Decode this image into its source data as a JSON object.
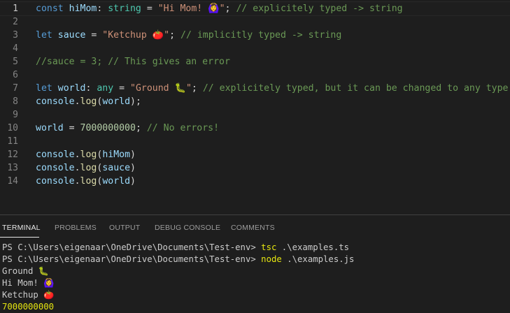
{
  "editor": {
    "lines": [
      {
        "num": "1",
        "parts": [
          [
            "kw",
            "const "
          ],
          [
            "var",
            "hiMom"
          ],
          [
            "op",
            ": "
          ],
          [
            "type",
            "string"
          ],
          [
            "op",
            " = "
          ],
          [
            "str",
            "\"Hi Mom! "
          ],
          [
            "emoji",
            "🙆‍♀️"
          ],
          [
            "str",
            "\""
          ],
          [
            "op",
            "; "
          ],
          [
            "com",
            "// explicitely typed -> string"
          ]
        ]
      },
      {
        "num": "2",
        "parts": []
      },
      {
        "num": "3",
        "parts": [
          [
            "kw",
            "let "
          ],
          [
            "var",
            "sauce"
          ],
          [
            "op",
            " = "
          ],
          [
            "str",
            "\"Ketchup "
          ],
          [
            "emoji",
            "🍅"
          ],
          [
            "str",
            "\""
          ],
          [
            "op",
            "; "
          ],
          [
            "com",
            "// implicitly typed -> string"
          ]
        ]
      },
      {
        "num": "4",
        "parts": []
      },
      {
        "num": "5",
        "parts": [
          [
            "com",
            "//sauce = 3; // This gives an error"
          ]
        ]
      },
      {
        "num": "6",
        "parts": []
      },
      {
        "num": "7",
        "parts": [
          [
            "kw",
            "let "
          ],
          [
            "var",
            "world"
          ],
          [
            "op",
            ": "
          ],
          [
            "type",
            "any"
          ],
          [
            "op",
            " = "
          ],
          [
            "str",
            "\"Ground "
          ],
          [
            "emoji",
            "🐛"
          ],
          [
            "str",
            "\""
          ],
          [
            "op",
            "; "
          ],
          [
            "com",
            "// explicitely typed, but it can be changed to any type!"
          ]
        ]
      },
      {
        "num": "8",
        "parts": [
          [
            "var",
            "console"
          ],
          [
            "op",
            "."
          ],
          [
            "fn",
            "log"
          ],
          [
            "op",
            "("
          ],
          [
            "var",
            "world"
          ],
          [
            "op",
            ");"
          ]
        ]
      },
      {
        "num": "9",
        "parts": []
      },
      {
        "num": "10",
        "parts": [
          [
            "var",
            "world"
          ],
          [
            "op",
            " = "
          ],
          [
            "num",
            "7000000000"
          ],
          [
            "op",
            "; "
          ],
          [
            "com",
            "// No errors!"
          ]
        ]
      },
      {
        "num": "11",
        "parts": []
      },
      {
        "num": "12",
        "parts": [
          [
            "var",
            "console"
          ],
          [
            "op",
            "."
          ],
          [
            "fn",
            "log"
          ],
          [
            "op",
            "("
          ],
          [
            "var",
            "hiMom"
          ],
          [
            "op",
            ")"
          ]
        ]
      },
      {
        "num": "13",
        "parts": [
          [
            "var",
            "console"
          ],
          [
            "op",
            "."
          ],
          [
            "fn",
            "log"
          ],
          [
            "op",
            "("
          ],
          [
            "var",
            "sauce"
          ],
          [
            "op",
            ")"
          ]
        ]
      },
      {
        "num": "14",
        "parts": [
          [
            "var",
            "console"
          ],
          [
            "op",
            "."
          ],
          [
            "fn",
            "log"
          ],
          [
            "op",
            "("
          ],
          [
            "var",
            "world"
          ],
          [
            "op",
            ")"
          ]
        ]
      }
    ]
  },
  "panel": {
    "tabs": [
      "TERMINAL",
      "PROBLEMS",
      "OUTPUT",
      "DEBUG CONSOLE",
      "COMMENTS"
    ]
  },
  "terminal": {
    "prompt1": "PS C:\\Users\\eigenaar\\OneDrive\\Documents\\Test-env> ",
    "cmd1": "tsc",
    "args1": " .\\examples.ts",
    "prompt2": "PS C:\\Users\\eigenaar\\OneDrive\\Documents\\Test-env> ",
    "cmd2": "node",
    "args2": " .\\examples.js",
    "out1": "Ground 🐛",
    "out2": "Hi Mom! 🙆‍♀️",
    "out3": "Ketchup 🍅",
    "out4": "7000000000"
  }
}
